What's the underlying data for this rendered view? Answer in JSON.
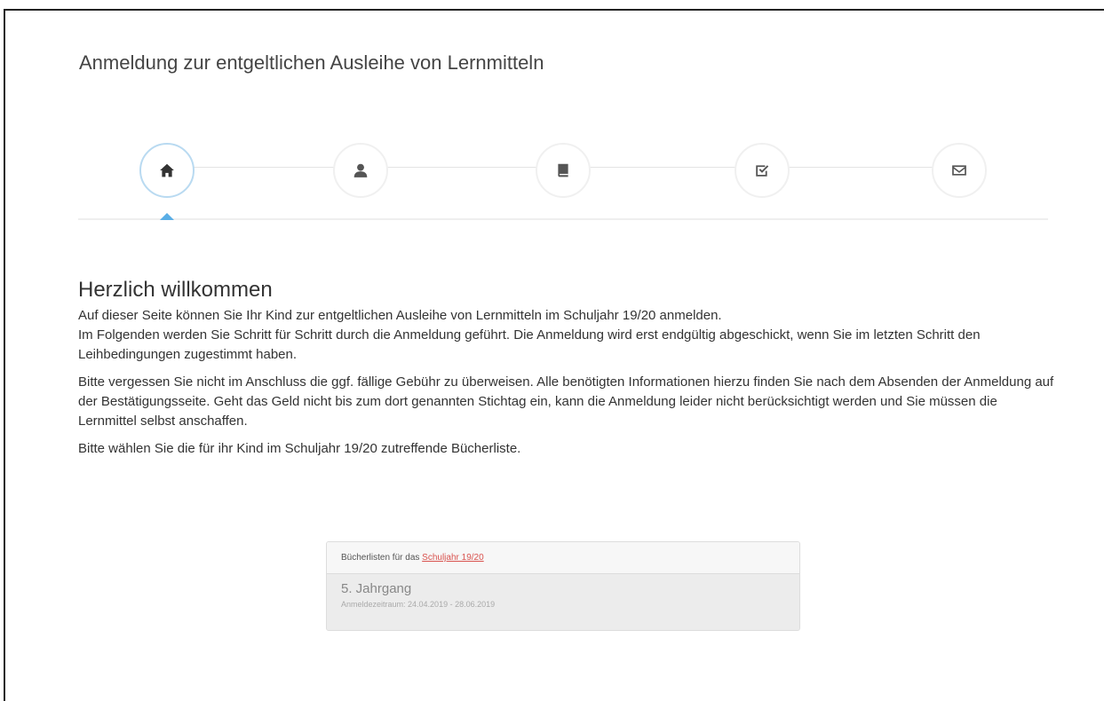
{
  "header": {
    "title": "Anmeldung zur entgeltlichen Ausleihe von Lernmitteln"
  },
  "wizard": {
    "steps": [
      {
        "icon": "home-icon",
        "active": true
      },
      {
        "icon": "user-icon",
        "active": false
      },
      {
        "icon": "book-icon",
        "active": false
      },
      {
        "icon": "check-icon",
        "active": false
      },
      {
        "icon": "envelope-icon",
        "active": false
      }
    ],
    "accent_color": "#5aaee6"
  },
  "main": {
    "heading": "Herzlich willkommen",
    "paragraph1_line1": "Auf dieser Seite können Sie Ihr Kind zur entgeltlichen Ausleihe von Lernmitteln im Schuljahr 19/20 anmelden.",
    "paragraph1_line2": "Im Folgenden werden Sie Schritt für Schritt durch die Anmeldung geführt. Die Anmeldung wird erst endgültig abgeschickt, wenn Sie im letzten Schritt den Leihbedingungen zugestimmt haben.",
    "paragraph2": "Bitte vergessen Sie nicht im Anschluss die ggf. fällige Gebühr zu überweisen. Alle benötigten Informationen hierzu finden Sie nach dem Absenden der Anmeldung auf der Bestätigungsseite. Geht das Geld nicht bis zum dort genannten Stichtag ein, kann die Anmeldung leider nicht berücksichtigt werden und Sie müssen die Lernmittel selbst anschaffen.",
    "paragraph3": "Bitte wählen Sie die für ihr Kind im Schuljahr 19/20 zutreffende Bücherliste."
  },
  "booklist": {
    "header_prefix": "Bücherlisten für das ",
    "header_link": "Schuljahr 19/20",
    "items": [
      {
        "title": "5. Jahrgang",
        "period": "Anmeldezeitraum: 24.04.2019 - 28.06.2019"
      }
    ]
  }
}
